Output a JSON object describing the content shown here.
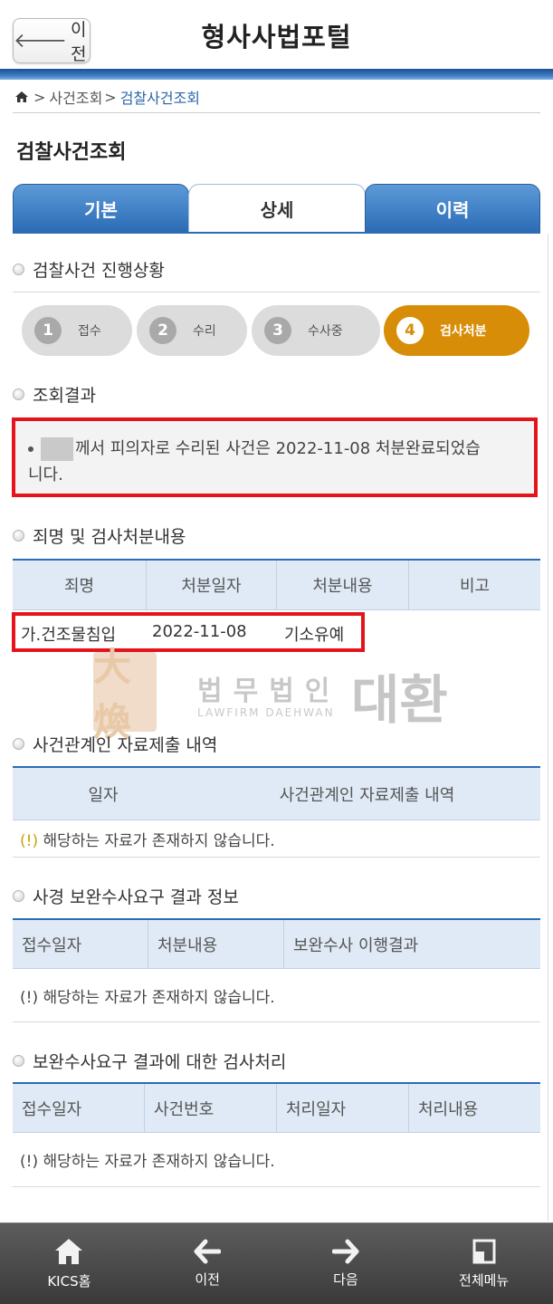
{
  "header": {
    "back_label": "이전",
    "title": "형사사법포털"
  },
  "breadcrumb": {
    "items": [
      "사건조회",
      "검찰사건조회"
    ],
    "sep": ">"
  },
  "page_title": "검찰사건조회",
  "tabs": [
    {
      "label": "기본"
    },
    {
      "label": "상세",
      "active": true
    },
    {
      "label": "이력"
    }
  ],
  "progress": {
    "title": "검찰사건 진행상황",
    "steps": [
      {
        "num": "1",
        "label": "접수"
      },
      {
        "num": "2",
        "label": "수리"
      },
      {
        "num": "3",
        "label": "수사중"
      },
      {
        "num": "4",
        "label": "검사처분",
        "active": true
      }
    ],
    "active_color": "#d88d08"
  },
  "result": {
    "title": "조회결과",
    "text_line1": "께서 피의자로 수리된 사건은 2022-11-08 처분완료되었습",
    "text_line2": "니다."
  },
  "disposition": {
    "title": "죄명 및 검사처분내용",
    "headers": [
      "죄명",
      "처분일자",
      "처분내용",
      "비고"
    ],
    "row": {
      "crime": "가.건조물침입",
      "date": "2022-11-08",
      "content": "기소유예"
    }
  },
  "watermark": {
    "korean": "법무법인",
    "english": "LAWFIRM DAEHWAN",
    "big": "대환",
    "logo_glyph": "大煥"
  },
  "submission": {
    "title": "사건관계인 자료제출 내역",
    "headers": [
      "일자",
      "사건관계인 자료제출 내역"
    ],
    "empty_mark": "(!)",
    "empty_text": "해당하는 자료가 존재하지 않습니다."
  },
  "supplement": {
    "title": "사경 보완수사요구 결과 정보",
    "headers": [
      "접수일자",
      "처분내용",
      "보완수사 이행결과"
    ],
    "empty_mark": "(!)",
    "empty_text": "해당하는 자료가 존재하지 않습니다."
  },
  "prosecution": {
    "title": "보완수사요구 결과에 대한 검사처리",
    "headers": [
      "접수일자",
      "사건번호",
      "처리일자",
      "처리내용"
    ],
    "empty_mark": "(!)",
    "empty_text": "해당하는 자료가 존재하지 않습니다."
  },
  "bottom_nav": [
    {
      "label": "KICS홈",
      "icon": "home-icon"
    },
    {
      "label": "이전",
      "icon": "arrow-left-icon"
    },
    {
      "label": "다음",
      "icon": "arrow-right-icon"
    },
    {
      "label": "전체메뉴",
      "icon": "menu-icon"
    }
  ],
  "colors": {
    "brand_blue": "#2c6cb5",
    "highlight_red": "#e5141c"
  }
}
